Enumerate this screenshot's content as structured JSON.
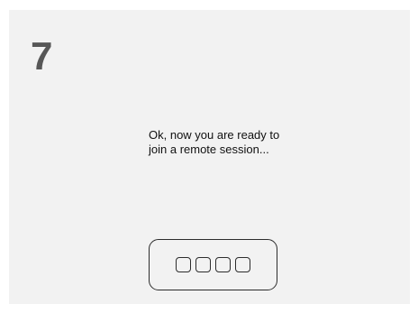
{
  "step": {
    "number": "7"
  },
  "message": {
    "line1": "Ok, now you are ready to",
    "line2": "join a remote session..."
  },
  "session_code": {
    "digits": [
      "",
      "",
      "",
      ""
    ]
  },
  "colors": {
    "panel_background": "#f2f2f2",
    "step_number": "#575757",
    "text": "#111111",
    "border": "#2c2c2c"
  }
}
